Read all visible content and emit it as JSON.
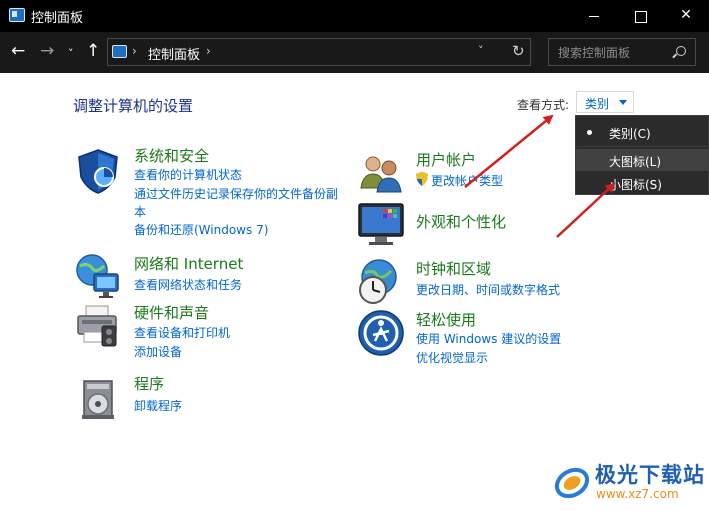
{
  "window": {
    "title": "控制面板",
    "minimize": "—",
    "maximize": "☐",
    "close": "✕"
  },
  "nav": {
    "back": "←",
    "forward": "→",
    "recent": "˅",
    "up": "↑",
    "address": "控制面板",
    "address_sep": "›",
    "refresh": "↻",
    "dropdown": "˅",
    "search_placeholder": "搜索控制面板"
  },
  "content": {
    "heading": "调整计算机的设置",
    "view_by_label": "查看方式:",
    "view_by_value": "类别"
  },
  "view_menu": {
    "items": [
      {
        "label": "类别(C)",
        "selected": true
      },
      {
        "label": "大图标(L)",
        "highlighted": true
      },
      {
        "label": "小图标(S)"
      }
    ]
  },
  "categories": [
    {
      "title": "系统和安全",
      "links": [
        "查看你的计算机状态",
        "通过文件历史记录保存你的文件备份副",
        "本",
        "备份和还原(Windows 7)"
      ],
      "icon": "shield-icon"
    },
    {
      "title": "网络和 Internet",
      "links": [
        "查看网络状态和任务"
      ],
      "icon": "network-globe-icon"
    },
    {
      "title": "硬件和声音",
      "links": [
        "查看设备和打印机",
        "添加设备"
      ],
      "icon": "printer-icon"
    },
    {
      "title": "程序",
      "links": [
        "卸载程序"
      ],
      "icon": "programs-disc-icon"
    },
    {
      "title": "用户帐户",
      "links": [
        "更改帐户类型"
      ],
      "icon": "users-icon"
    },
    {
      "title": "外观和个性化",
      "links": [],
      "icon": "monitor-palette-icon"
    },
    {
      "title": "时钟和区域",
      "links": [
        "更改日期、时间或数字格式"
      ],
      "icon": "clock-globe-icon"
    },
    {
      "title": "轻松使用",
      "links": [
        "使用 Windows 建议的设置",
        "优化视觉显示"
      ],
      "icon": "accessibility-icon"
    }
  ],
  "watermark": {
    "title": "极光下载站",
    "url": "www.xz7.com"
  },
  "colors": {
    "titlebar": "#000000",
    "navbar": "#191919",
    "category_title": "#1a7a1a",
    "link": "#0066cc",
    "heading": "#1e3287",
    "arrow": "#d02020"
  }
}
